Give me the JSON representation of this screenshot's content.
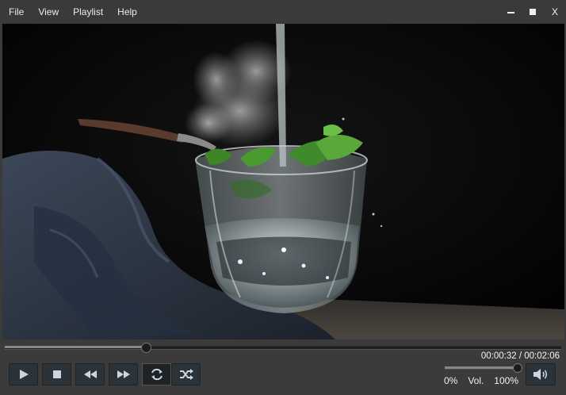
{
  "menu": {
    "items": [
      "File",
      "View",
      "Playlist",
      "Help"
    ]
  },
  "window": {
    "close_label": "X"
  },
  "playback": {
    "position_fraction": 0.254,
    "time_display": "00:00:32 / 00:02:06"
  },
  "controls": {
    "buttons": [
      "play-icon",
      "stop-icon",
      "rewind-icon",
      "fast-forward-icon",
      "repeat-icon",
      "shuffle-icon"
    ],
    "repeat_active": true
  },
  "volume": {
    "level_percent": 100,
    "min_label": "0%",
    "label": "Vol.",
    "max_label": "100%"
  },
  "colors": {
    "background": "#3b3b3b",
    "button": "#2b3338",
    "icon": "#c9d6e2"
  }
}
